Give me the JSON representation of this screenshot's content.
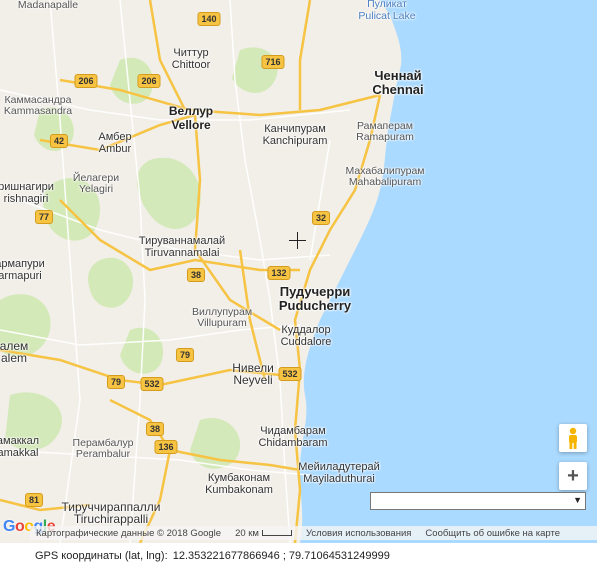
{
  "map": {
    "cities": [
      {
        "id": "madanapalle",
        "lines": [
          "Madanapalle"
        ],
        "style": "small"
      },
      {
        "id": "chittoor",
        "lines": [
          "Читтур",
          "Chittoor"
        ],
        "style": "normal"
      },
      {
        "id": "pulicat",
        "lines": [
          "Пуликат",
          "Pulicat Lake"
        ],
        "style": "water"
      },
      {
        "id": "chennai",
        "lines": [
          "Ченнай",
          "Chennai"
        ],
        "style": "big"
      },
      {
        "id": "kammasandra",
        "lines": [
          "Каммасандра",
          "Kammasandra"
        ],
        "style": "small"
      },
      {
        "id": "vellore",
        "lines": [
          "Веллур",
          "Vellore"
        ],
        "style": "normal"
      },
      {
        "id": "kanchipuram",
        "lines": [
          "Канчипурам",
          "Kanchipuram"
        ],
        "style": "normal"
      },
      {
        "id": "ramapuram",
        "lines": [
          "Рамаперам",
          "Ramapuram"
        ],
        "style": "small"
      },
      {
        "id": "ambur",
        "lines": [
          "Амбер",
          "Ambur"
        ],
        "style": "normal"
      },
      {
        "id": "yelagiri",
        "lines": [
          "Йелагери",
          "Yelagiri"
        ],
        "style": "small"
      },
      {
        "id": "krishnagiri",
        "lines": [
          "ришнагири",
          "rishnagiri"
        ],
        "style": "small"
      },
      {
        "id": "mahabalipuram",
        "lines": [
          "Махабалипурам",
          "Mahabalipuram"
        ],
        "style": "small"
      },
      {
        "id": "tiruvannamalai",
        "lines": [
          "Тируваннамалай",
          "Tiruvannamalai"
        ],
        "style": "normal"
      },
      {
        "id": "dharmapuri",
        "lines": [
          "армапури",
          "armapuri"
        ],
        "style": "small"
      },
      {
        "id": "puducherry",
        "lines": [
          "Пудучерри",
          "Puducherry"
        ],
        "style": "big"
      },
      {
        "id": "villupuram",
        "lines": [
          "Виллупурам",
          "Villupuram"
        ],
        "style": "small"
      },
      {
        "id": "cuddalore",
        "lines": [
          "Куддалор",
          "Cuddalore"
        ],
        "style": "normal"
      },
      {
        "id": "salem",
        "lines": [
          "алем",
          "alem"
        ],
        "style": "normal"
      },
      {
        "id": "neyveli",
        "lines": [
          "Нивели",
          "Neyveli"
        ],
        "style": "normal"
      },
      {
        "id": "namakkal",
        "lines": [
          "амаккал",
          "amakkal"
        ],
        "style": "normal"
      },
      {
        "id": "perambalur",
        "lines": [
          "Перамбалур",
          "Perambalur"
        ],
        "style": "small"
      },
      {
        "id": "chidambaram",
        "lines": [
          "Чидамбарам",
          "Chidambaram"
        ],
        "style": "normal"
      },
      {
        "id": "mayiladuthurai",
        "lines": [
          "Мейиладутерай",
          "Mayiladuthurai"
        ],
        "style": "normal"
      },
      {
        "id": "kumbakonam",
        "lines": [
          "Кумбаконам",
          "Kumbakonam"
        ],
        "style": "normal"
      },
      {
        "id": "tiruchirappalli",
        "lines": [
          "Тируччираппалли",
          "Tiruchirappalli"
        ],
        "style": "normal"
      }
    ],
    "shields": [
      {
        "id": "s140",
        "label": "140"
      },
      {
        "id": "s716",
        "label": "716"
      },
      {
        "id": "s206a",
        "label": "206"
      },
      {
        "id": "s206b",
        "label": "206"
      },
      {
        "id": "s42",
        "label": "42"
      },
      {
        "id": "s77",
        "label": "77"
      },
      {
        "id": "s32",
        "label": "32"
      },
      {
        "id": "s132",
        "label": "132"
      },
      {
        "id": "s38a",
        "label": "38"
      },
      {
        "id": "s79a",
        "label": "79"
      },
      {
        "id": "s79b",
        "label": "79"
      },
      {
        "id": "s532a",
        "label": "532"
      },
      {
        "id": "s532b",
        "label": "532"
      },
      {
        "id": "s38b",
        "label": "38"
      },
      {
        "id": "s136",
        "label": "136"
      },
      {
        "id": "s81",
        "label": "81"
      }
    ]
  },
  "controls": {
    "zoom_in_label": "+",
    "select_arrow": "▼"
  },
  "attribution": {
    "logo": [
      "G",
      "o",
      "o",
      "g",
      "l",
      "e"
    ],
    "logo_colors": [
      "#4285F4",
      "#EA4335",
      "#FBBC05",
      "#4285F4",
      "#34A853",
      "#EA4335"
    ],
    "map_data": "Картографические данные © 2018 Google",
    "scale": "20 км",
    "terms": "Условия использования",
    "report": "Сообщить об ошибке на карте"
  },
  "gps": {
    "label": "GPS координаты (lat, lng):",
    "value": "12.353221677866946 ; 79.71064531249999"
  },
  "colors": {
    "land": "#f2efe9",
    "water": "#aadaff",
    "green": "#cfe8b0",
    "highway": "#f6c342",
    "road": "#ffffff"
  }
}
